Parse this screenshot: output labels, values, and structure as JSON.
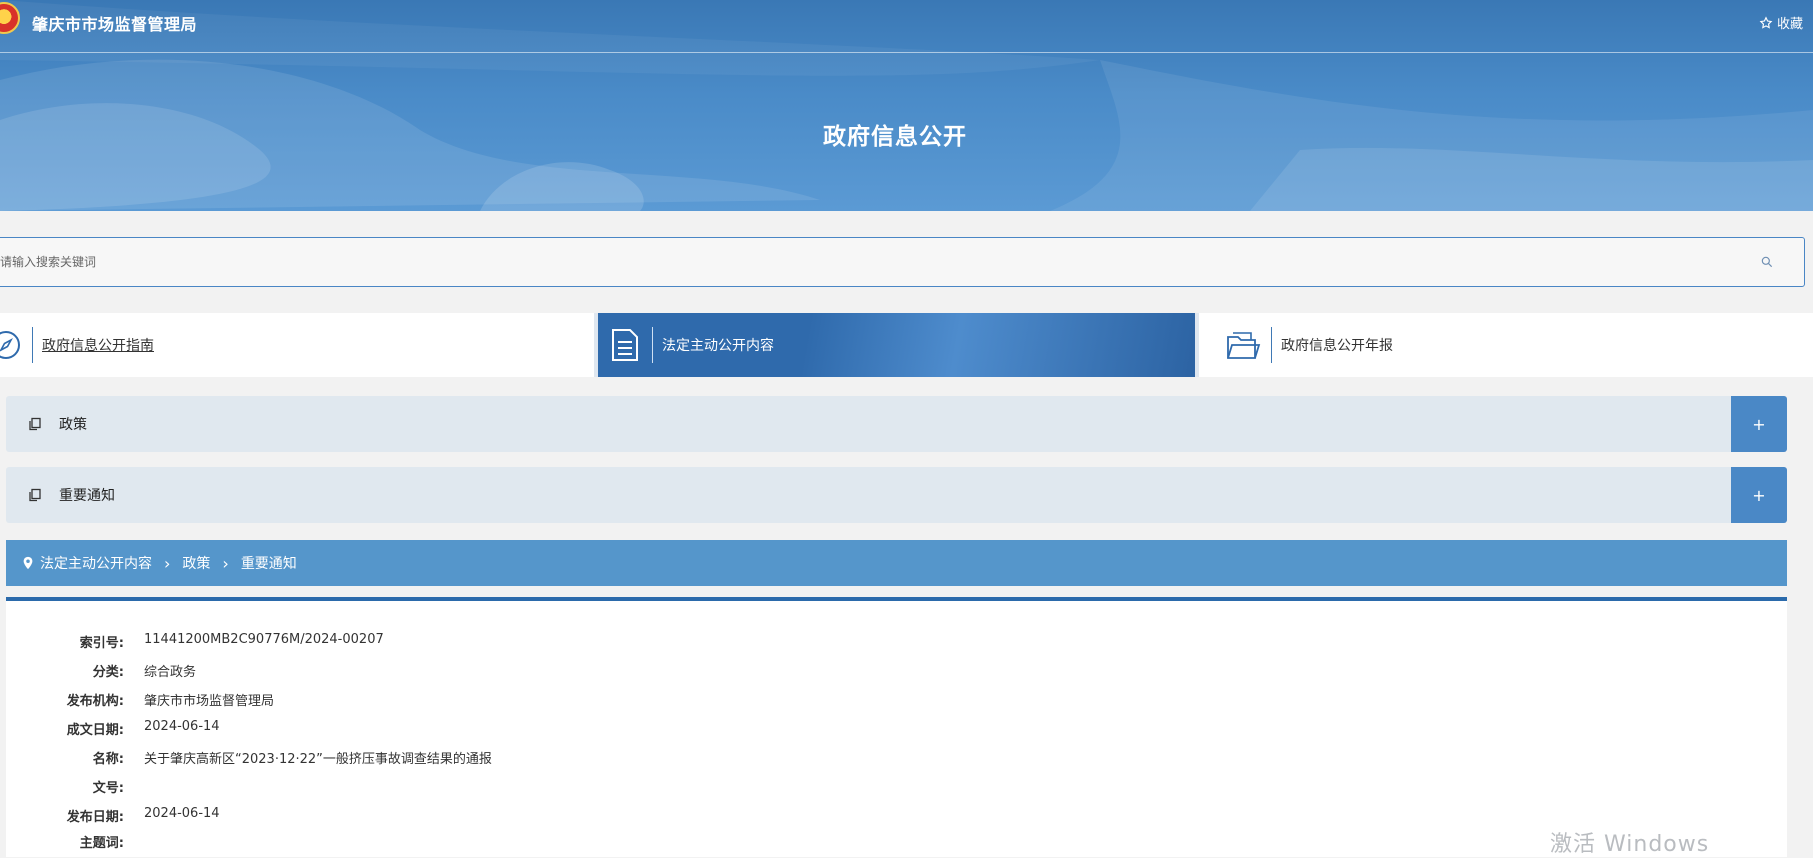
{
  "header": {
    "site_name": "肇庆市市场监督管理局",
    "favorite_label": "收藏",
    "page_heading": "政府信息公开"
  },
  "search": {
    "placeholder": "请输入搜索关键词"
  },
  "tabs": [
    {
      "label": "政府信息公开指南",
      "icon": "compass-icon",
      "active": false
    },
    {
      "label": "法定主动公开内容",
      "icon": "document-icon",
      "active": true
    },
    {
      "label": "政府信息公开年报",
      "icon": "folder-icon",
      "active": false
    }
  ],
  "accordion": [
    {
      "label": "政策",
      "toggle": "+"
    },
    {
      "label": "重要通知",
      "toggle": "+"
    }
  ],
  "breadcrumb": {
    "items": [
      "法定主动公开内容",
      "政策",
      "重要通知"
    ]
  },
  "detail": {
    "rows": [
      {
        "key": "索引号:",
        "value": "11441200MB2C90776M/2024-00207"
      },
      {
        "key": "分类:",
        "value": "综合政务"
      },
      {
        "key": "发布机构:",
        "value": "肇庆市市场监督管理局"
      },
      {
        "key": "成文日期:",
        "value": "2024-06-14"
      },
      {
        "key": "名称:",
        "value": "关于肇庆高新区“2023·12·22”一般挤压事故调查结果的通报"
      },
      {
        "key": "文号:",
        "value": ""
      },
      {
        "key": "发布日期:",
        "value": "2024-06-14"
      },
      {
        "key": "主题词:",
        "value": ""
      }
    ]
  },
  "watermark": "激活 Windows",
  "colors": {
    "banner": "#4a8bc8",
    "accent": "#2f6aac",
    "breadcrumb_bg": "#5596cb",
    "accordion_bg": "#e0e8ef",
    "accordion_toggle": "#4a88c6"
  }
}
